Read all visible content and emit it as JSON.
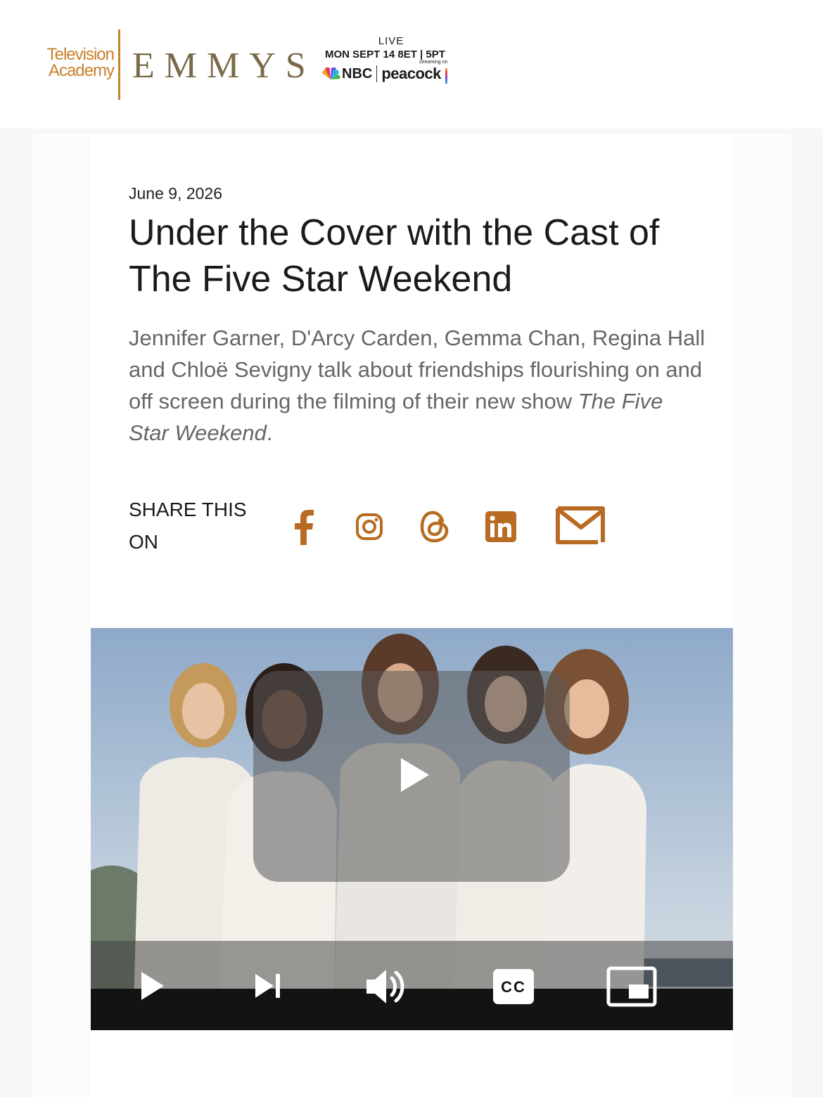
{
  "header": {
    "logo_line1": "Television",
    "logo_line2": "Academy",
    "emmys": "EMMYS",
    "live": "LIVE",
    "broadcast_date": "MON SEPT 14 8ET | 5PT",
    "network": "NBC",
    "streaming_on": "streaming on",
    "streamer": "peacock"
  },
  "article": {
    "date": "June 9, 2026",
    "title": "Under the Cover with the Cast of The Five Star Weekend",
    "dek_text": "Jennifer Garner, D'Arcy Carden, Gemma Chan, Regina Hall and Chloë Sevigny talk about friendships flourishing on and off screen during the filming of their new show ",
    "dek_italic": "The Five Star Weekend",
    "dek_end": "."
  },
  "share": {
    "label": "SHARE THIS ON",
    "icons": [
      "facebook-icon",
      "instagram-icon",
      "threads-icon",
      "linkedin-icon",
      "email-icon"
    ],
    "icon_color": "#b86b22"
  },
  "video": {
    "controls": [
      "play-icon",
      "next-icon",
      "volume-icon",
      "closed-captions-icon",
      "picture-in-picture-icon"
    ],
    "cc_label": "CC"
  }
}
